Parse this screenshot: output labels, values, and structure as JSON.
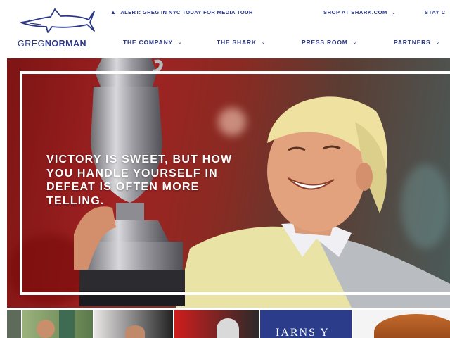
{
  "brand": {
    "logo_name_light": "GREG",
    "logo_name_bold": "NORMAN"
  },
  "header": {
    "alert_text": "ALERT: GREG IN NYC TODAY FOR MEDIA TOUR",
    "shop_label": "SHOP AT SHARK.COM",
    "stay_label": "STAY C"
  },
  "nav": {
    "items": [
      {
        "label": "THE COMPANY"
      },
      {
        "label": "THE SHARK"
      },
      {
        "label": "PRESS ROOM"
      },
      {
        "label": "PARTNERS"
      }
    ]
  },
  "hero": {
    "quote": "VICTORY IS SWEET, BUT HOW YOU HANDLE YOURSELF IN DEFEAT IS OFTEN MORE TELLING."
  },
  "strip": {
    "thumb_text": "IARNS Y"
  },
  "colors": {
    "brand_navy": "#2a3788",
    "hero_red": "#a12222",
    "white": "#ffffff"
  },
  "icons": [
    "shark-logo-icon",
    "alert-icon",
    "chevron-down-icon"
  ]
}
